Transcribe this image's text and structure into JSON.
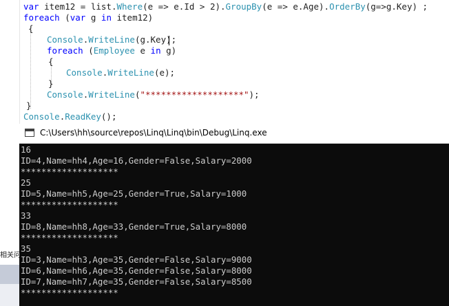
{
  "editor": {
    "lines": [
      [
        {
          "t": "var ",
          "c": "kw"
        },
        {
          "t": "item12 = list.",
          "c": "id"
        },
        {
          "t": "Where",
          "c": "ty"
        },
        {
          "t": "(e => e.Id > 2).",
          "c": "id"
        },
        {
          "t": "GroupBy",
          "c": "ty"
        },
        {
          "t": "(e => e.Age).",
          "c": "id"
        },
        {
          "t": "OrderBy",
          "c": "ty"
        },
        {
          "t": "(g=>g.Key) ;",
          "c": "id"
        }
      ],
      [
        {
          "t": "foreach ",
          "c": "kw"
        },
        {
          "t": "(",
          "c": "id"
        },
        {
          "t": "var ",
          "c": "kw"
        },
        {
          "t": "g ",
          "c": "id"
        },
        {
          "t": "in ",
          "c": "kw"
        },
        {
          "t": "item12)",
          "c": "id"
        }
      ],
      [
        {
          "t": "{",
          "c": "id"
        }
      ],
      [
        {
          "t": "Console",
          "c": "ty"
        },
        {
          "t": ".",
          "c": "id"
        },
        {
          "t": "WriteLine",
          "c": "ty"
        },
        {
          "t": "(g.Key);",
          "c": "id"
        }
      ],
      [
        {
          "t": "foreach ",
          "c": "kw"
        },
        {
          "t": "(",
          "c": "id"
        },
        {
          "t": "Employee ",
          "c": "ty"
        },
        {
          "t": "e ",
          "c": "id"
        },
        {
          "t": "in ",
          "c": "kw"
        },
        {
          "t": "g)",
          "c": "id"
        }
      ],
      [
        {
          "t": "{",
          "c": "id"
        }
      ],
      [
        {
          "t": "Console",
          "c": "ty"
        },
        {
          "t": ".",
          "c": "id"
        },
        {
          "t": "WriteLine",
          "c": "ty"
        },
        {
          "t": "(e);",
          "c": "id"
        }
      ],
      [
        {
          "t": "}",
          "c": "id"
        }
      ],
      [
        {
          "t": "Console",
          "c": "ty"
        },
        {
          "t": ".",
          "c": "id"
        },
        {
          "t": "WriteLine",
          "c": "ty"
        },
        {
          "t": "(",
          "c": "id"
        },
        {
          "t": "\"*******************\"",
          "c": "st"
        },
        {
          "t": ");",
          "c": "id"
        }
      ],
      [
        {
          "t": "}",
          "c": "id"
        }
      ],
      [
        {
          "t": "Console",
          "c": "ty"
        },
        {
          "t": ".",
          "c": "id"
        },
        {
          "t": "ReadKey",
          "c": "ty"
        },
        {
          "t": "();",
          "c": "id"
        }
      ]
    ]
  },
  "side_panel": {
    "label": "相关问题"
  },
  "console": {
    "title": "C:\\Users\\hh\\source\\repos\\Linq\\Linq\\bin\\Debug\\Linq.exe",
    "icon": "console-app-icon",
    "output": [
      "16",
      "ID=4,Name=hh4,Age=16,Gender=False,Salary=2000",
      "*******************",
      "25",
      "ID=5,Name=hh5,Age=25,Gender=True,Salary=1000",
      "*******************",
      "33",
      "ID=8,Name=hh8,Age=33,Gender=True,Salary=8000",
      "*******************",
      "35",
      "ID=3,Name=hh3,Age=35,Gender=False,Salary=9000",
      "ID=6,Name=hh6,Age=35,Gender=False,Salary=8000",
      "ID=7,Name=hh7,Age=35,Gender=False,Salary=8500",
      "*******************"
    ]
  }
}
